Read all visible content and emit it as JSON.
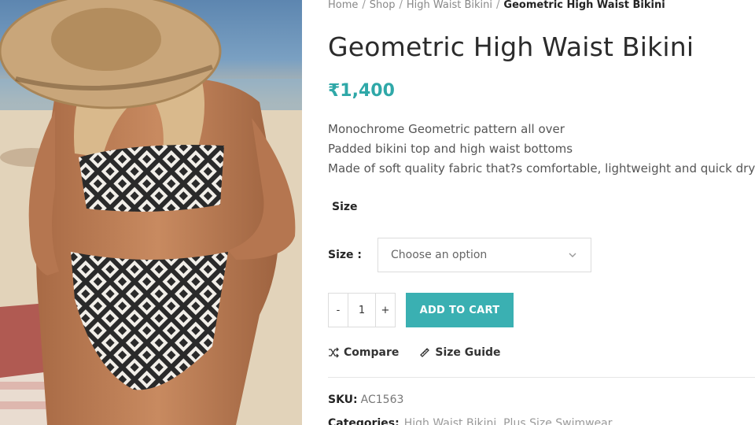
{
  "image": {
    "alt": "Model wearing geometric high waist bikini with a straw hat on the beach"
  },
  "breadcrumb": {
    "items": [
      "Home",
      "Shop",
      "High Waist Bikini"
    ],
    "current": "Geometric High Waist Bikini",
    "separator": "/"
  },
  "product": {
    "title": "Geometric High Waist Bikini",
    "price": "₹1,400",
    "description": [
      "Monochrome Geometric pattern all over",
      "Padded bikini top and high waist bottoms",
      "Made of soft quality fabric that?s comfortable, lightweight and quick dry"
    ]
  },
  "size": {
    "heading": "Size",
    "label": "Size :",
    "placeholder": "Choose an option"
  },
  "quantity": {
    "minus": "-",
    "value": "1",
    "plus": "+"
  },
  "cart_button": "ADD TO CART",
  "actions": {
    "compare": "Compare",
    "size_guide": "Size Guide"
  },
  "sku": {
    "label": "SKU:",
    "value": "AC1563"
  },
  "categories": {
    "label": "Categories:",
    "value": "High Waist Bikini, Plus Size Swimwear"
  },
  "colors": {
    "accent": "#3ab0b2",
    "price": "#2fa8a8",
    "text_dark": "#2b2b2b",
    "muted": "#888888"
  }
}
